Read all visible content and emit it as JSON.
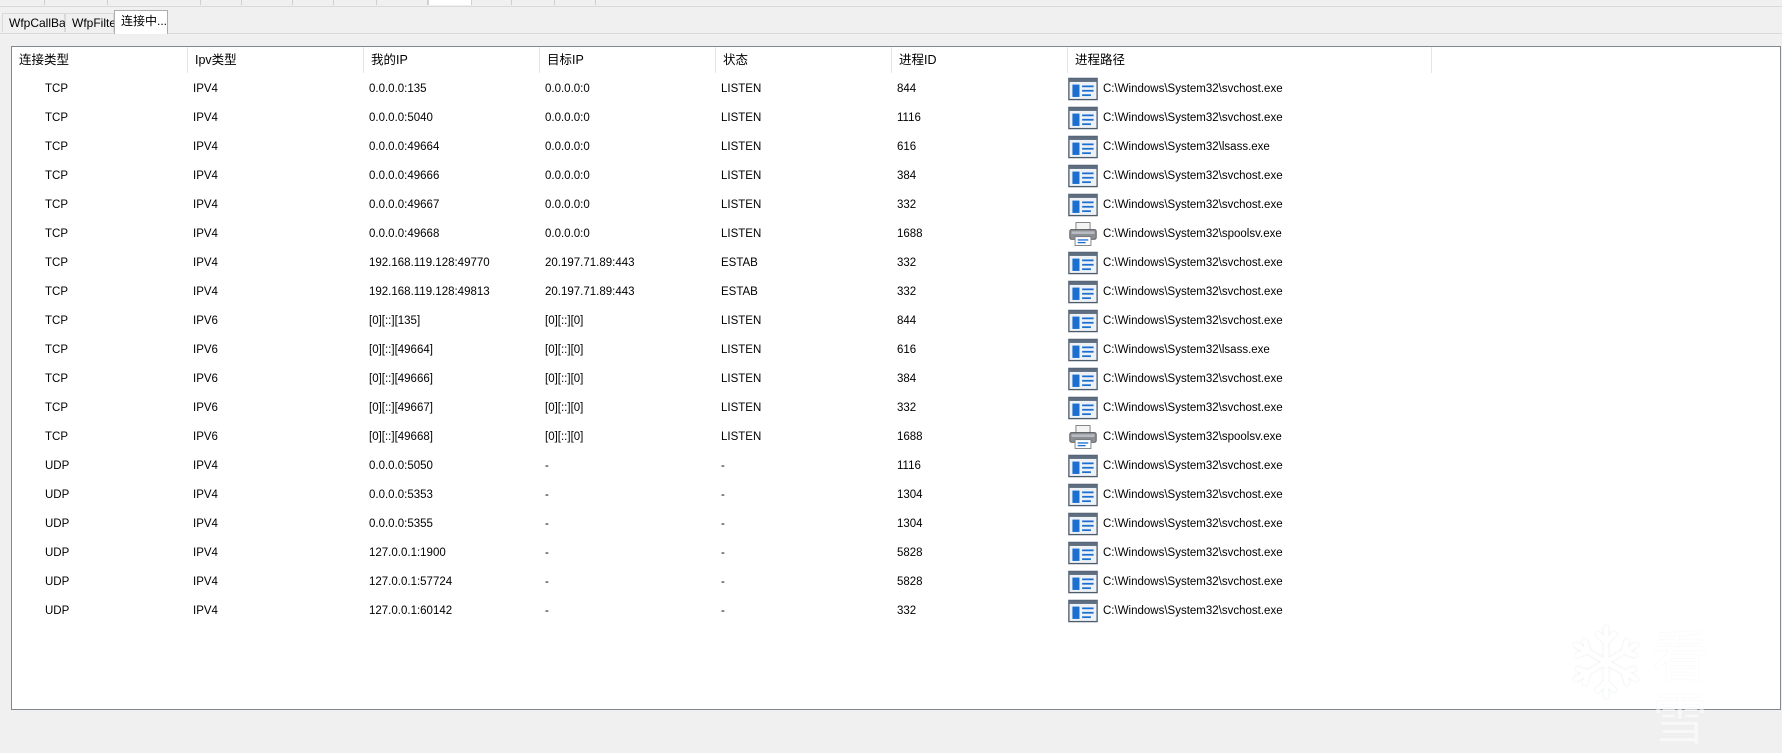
{
  "tabs": [
    {
      "label": "WfpCallBack"
    },
    {
      "label": "WfpFilter"
    },
    {
      "label": "连接中..."
    }
  ],
  "table": {
    "columns": [
      "连接类型",
      "Ipv类型",
      "我的IP",
      "目标IP",
      "状态",
      "进程ID",
      "进程路径"
    ],
    "rows": [
      {
        "proto": "TCP",
        "ipv": "IPV4",
        "local": "0.0.0.0:135",
        "remote": "0.0.0.0:0",
        "state": "LISTEN",
        "pid": "844",
        "path": "C:\\Windows\\System32\\svchost.exe",
        "icon": "service-window-icon"
      },
      {
        "proto": "TCP",
        "ipv": "IPV4",
        "local": "0.0.0.0:5040",
        "remote": "0.0.0.0:0",
        "state": "LISTEN",
        "pid": "1116",
        "path": "C:\\Windows\\System32\\svchost.exe",
        "icon": "service-window-icon"
      },
      {
        "proto": "TCP",
        "ipv": "IPV4",
        "local": "0.0.0.0:49664",
        "remote": "0.0.0.0:0",
        "state": "LISTEN",
        "pid": "616",
        "path": "C:\\Windows\\System32\\lsass.exe",
        "icon": "service-window-icon"
      },
      {
        "proto": "TCP",
        "ipv": "IPV4",
        "local": "0.0.0.0:49666",
        "remote": "0.0.0.0:0",
        "state": "LISTEN",
        "pid": "384",
        "path": "C:\\Windows\\System32\\svchost.exe",
        "icon": "service-window-icon"
      },
      {
        "proto": "TCP",
        "ipv": "IPV4",
        "local": "0.0.0.0:49667",
        "remote": "0.0.0.0:0",
        "state": "LISTEN",
        "pid": "332",
        "path": "C:\\Windows\\System32\\svchost.exe",
        "icon": "service-window-icon"
      },
      {
        "proto": "TCP",
        "ipv": "IPV4",
        "local": "0.0.0.0:49668",
        "remote": "0.0.0.0:0",
        "state": "LISTEN",
        "pid": "1688",
        "path": "C:\\Windows\\System32\\spoolsv.exe",
        "icon": "printer-icon"
      },
      {
        "proto": "TCP",
        "ipv": "IPV4",
        "local": "192.168.119.128:49770",
        "remote": "20.197.71.89:443",
        "state": "ESTAB",
        "pid": "332",
        "path": "C:\\Windows\\System32\\svchost.exe",
        "icon": "service-window-icon"
      },
      {
        "proto": "TCP",
        "ipv": "IPV4",
        "local": "192.168.119.128:49813",
        "remote": "20.197.71.89:443",
        "state": "ESTAB",
        "pid": "332",
        "path": "C:\\Windows\\System32\\svchost.exe",
        "icon": "service-window-icon"
      },
      {
        "proto": "TCP",
        "ipv": "IPV6",
        "local": "[0][::][135]",
        "remote": "[0][::][0]",
        "state": "LISTEN",
        "pid": "844",
        "path": "C:\\Windows\\System32\\svchost.exe",
        "icon": "service-window-icon"
      },
      {
        "proto": "TCP",
        "ipv": "IPV6",
        "local": "[0][::][49664]",
        "remote": "[0][::][0]",
        "state": "LISTEN",
        "pid": "616",
        "path": "C:\\Windows\\System32\\lsass.exe",
        "icon": "service-window-icon"
      },
      {
        "proto": "TCP",
        "ipv": "IPV6",
        "local": "[0][::][49666]",
        "remote": "[0][::][0]",
        "state": "LISTEN",
        "pid": "384",
        "path": "C:\\Windows\\System32\\svchost.exe",
        "icon": "service-window-icon"
      },
      {
        "proto": "TCP",
        "ipv": "IPV6",
        "local": "[0][::][49667]",
        "remote": "[0][::][0]",
        "state": "LISTEN",
        "pid": "332",
        "path": "C:\\Windows\\System32\\svchost.exe",
        "icon": "service-window-icon"
      },
      {
        "proto": "TCP",
        "ipv": "IPV6",
        "local": "[0][::][49668]",
        "remote": "[0][::][0]",
        "state": "LISTEN",
        "pid": "1688",
        "path": "C:\\Windows\\System32\\spoolsv.exe",
        "icon": "printer-icon"
      },
      {
        "proto": "UDP",
        "ipv": "IPV4",
        "local": "0.0.0.0:5050",
        "remote": "-",
        "state": "-",
        "pid": "1116",
        "path": "C:\\Windows\\System32\\svchost.exe",
        "icon": "service-window-icon"
      },
      {
        "proto": "UDP",
        "ipv": "IPV4",
        "local": "0.0.0.0:5353",
        "remote": "-",
        "state": "-",
        "pid": "1304",
        "path": "C:\\Windows\\System32\\svchost.exe",
        "icon": "service-window-icon"
      },
      {
        "proto": "UDP",
        "ipv": "IPV4",
        "local": "0.0.0.0:5355",
        "remote": "-",
        "state": "-",
        "pid": "1304",
        "path": "C:\\Windows\\System32\\svchost.exe",
        "icon": "service-window-icon"
      },
      {
        "proto": "UDP",
        "ipv": "IPV4",
        "local": "127.0.0.1:1900",
        "remote": "-",
        "state": "-",
        "pid": "5828",
        "path": "C:\\Windows\\System32\\svchost.exe",
        "icon": "service-window-icon"
      },
      {
        "proto": "UDP",
        "ipv": "IPV4",
        "local": "127.0.0.1:57724",
        "remote": "-",
        "state": "-",
        "pid": "5828",
        "path": "C:\\Windows\\System32\\svchost.exe",
        "icon": "service-window-icon"
      },
      {
        "proto": "UDP",
        "ipv": "IPV4",
        "local": "127.0.0.1:60142",
        "remote": "-",
        "state": "-",
        "pid": "332",
        "path": "C:\\Windows\\System32\\svchost.exe",
        "icon": "service-window-icon"
      }
    ]
  },
  "watermark": {
    "text": "看雪"
  },
  "colors": {
    "window_bg": "#f0f0f0",
    "panel_bg": "#ffffff",
    "panel_border": "#828790",
    "icon_blue": "#1b6fd0",
    "icon_frame": "#4d5b6b"
  }
}
